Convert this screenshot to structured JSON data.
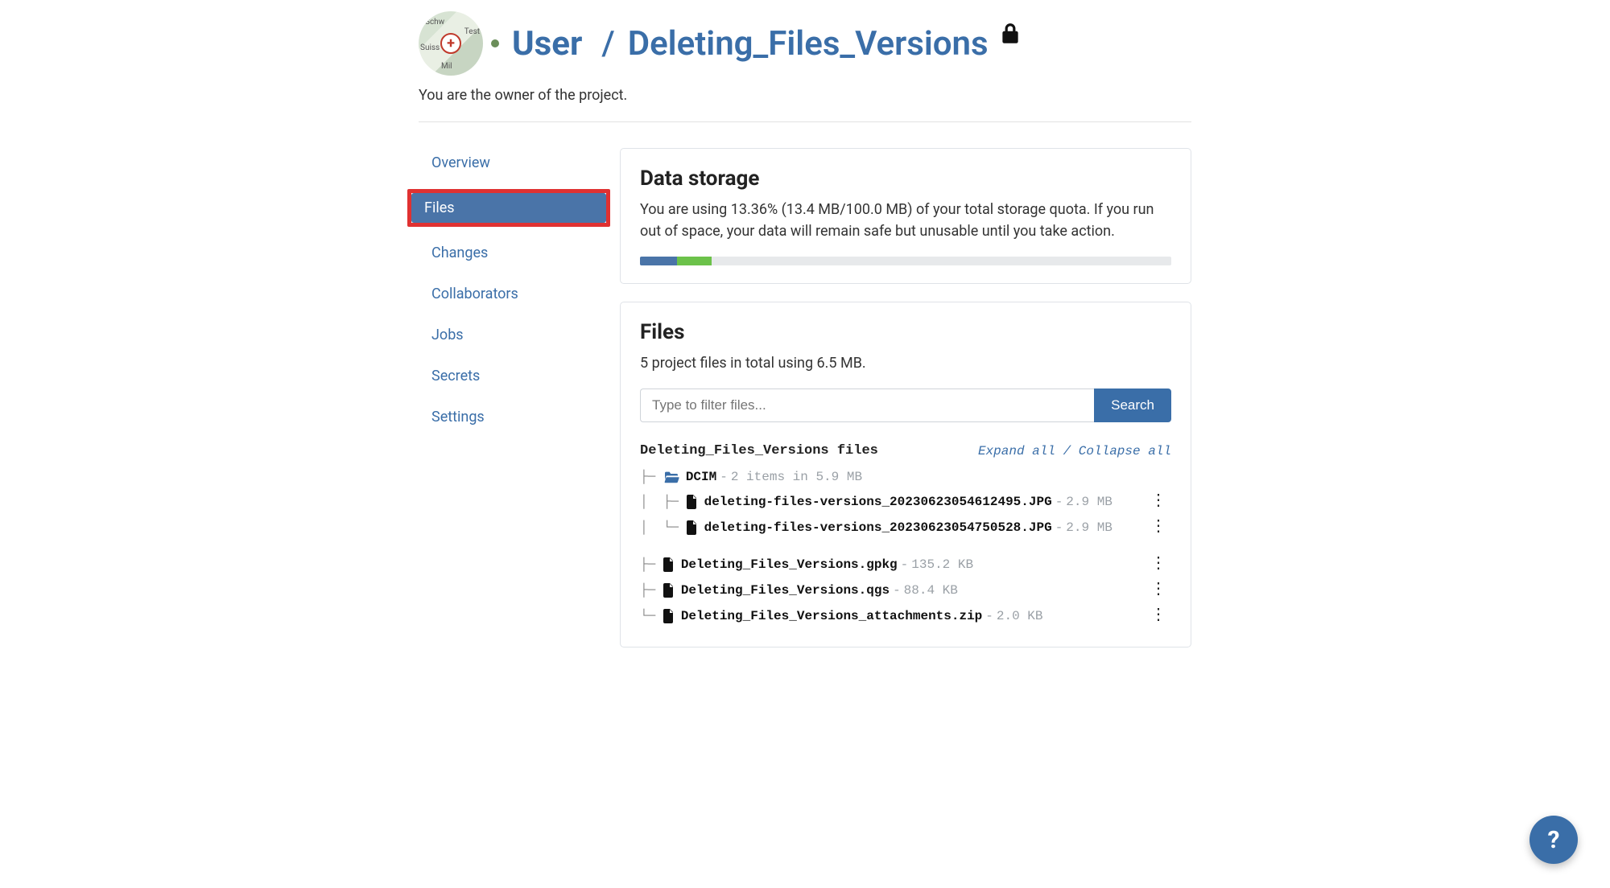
{
  "header": {
    "user_label": "User",
    "separator": "/",
    "project_name": "Deleting_Files_Versions",
    "owner_message": "You are the owner of the project."
  },
  "sidebar": {
    "items": [
      {
        "label": "Overview",
        "active": false
      },
      {
        "label": "Files",
        "active": true,
        "highlighted": true
      },
      {
        "label": "Changes",
        "active": false
      },
      {
        "label": "Collaborators",
        "active": false
      },
      {
        "label": "Jobs",
        "active": false
      },
      {
        "label": "Secrets",
        "active": false
      },
      {
        "label": "Settings",
        "active": false
      }
    ]
  },
  "storage": {
    "title": "Data storage",
    "text": "You are using 13.36% (13.4 MB/100.0 MB) of your total storage quota. If you run out of space, your data will remain safe but unusable until you take action.",
    "segment1_pct": 7,
    "segment2_pct": 6.5
  },
  "files_section": {
    "title": "Files",
    "summary": "5 project files in total using 6.5 MB.",
    "filter_placeholder": "Type to filter files...",
    "search_btn": "Search",
    "tree_title": "Deleting_Files_Versions files",
    "expand": "Expand all",
    "collapse": "Collapse all",
    "sep": " / "
  },
  "tree": {
    "folder": {
      "name": "DCIM",
      "meta": "2 items in 5.9 MB",
      "children": [
        {
          "name": "deleting-files-versions_20230623054612495.JPG",
          "size": "2.9 MB"
        },
        {
          "name": "deleting-files-versions_20230623054750528.JPG",
          "size": "2.9 MB"
        }
      ]
    },
    "root_files": [
      {
        "name": "Deleting_Files_Versions.gpkg",
        "size": "135.2 KB"
      },
      {
        "name": "Deleting_Files_Versions.qgs",
        "size": "88.4 KB"
      },
      {
        "name": "Deleting_Files_Versions_attachments.zip",
        "size": "2.0 KB"
      }
    ]
  },
  "help_label": "?"
}
